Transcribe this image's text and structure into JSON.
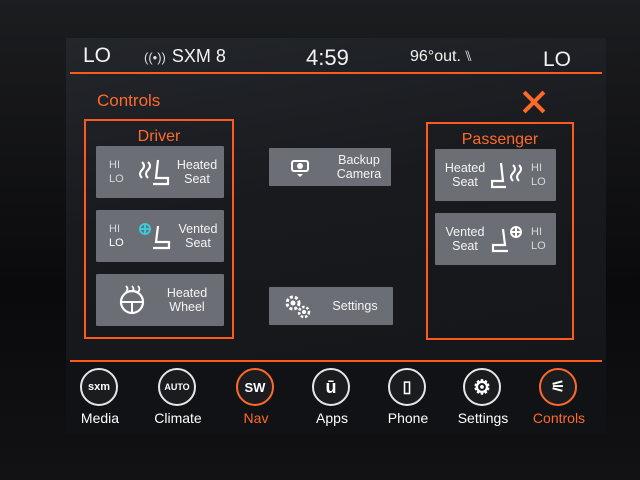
{
  "status": {
    "climate_left": "LO",
    "radio": "SXM 8",
    "time": "4:59",
    "outside_temp": "96°out.",
    "climate_right": "LO"
  },
  "page_title": "Controls",
  "driver": {
    "title": "Driver",
    "heated_seat": {
      "hi": "HI",
      "lo": "LO",
      "label_1": "Heated",
      "label_2": "Seat"
    },
    "vented_seat": {
      "hi": "HI",
      "lo": "LO",
      "label_1": "Vented",
      "label_2": "Seat"
    },
    "heated_wheel": {
      "label_1": "Heated",
      "label_2": "Wheel"
    }
  },
  "center": {
    "backup_camera": {
      "label_1": "Backup",
      "label_2": "Camera"
    },
    "settings": {
      "label": "Settings"
    }
  },
  "passenger": {
    "title": "Passenger",
    "heated_seat": {
      "hi": "HI",
      "lo": "LO",
      "label_1": "Heated",
      "label_2": "Seat"
    },
    "vented_seat": {
      "hi": "HI",
      "lo": "LO",
      "label_1": "Vented",
      "label_2": "Seat"
    }
  },
  "dock": [
    {
      "icon_text": "sxm",
      "label": "Media"
    },
    {
      "icon_text": "AUTO",
      "label": "Climate"
    },
    {
      "icon_text": "SW",
      "label": "Nav"
    },
    {
      "icon_text": "ū",
      "label": "Apps"
    },
    {
      "icon_text": "▯",
      "label": "Phone"
    },
    {
      "icon_text": "⚙",
      "label": "Settings"
    },
    {
      "icon_text": "⚟",
      "label": "Controls"
    }
  ],
  "colors": {
    "accent": "#ff5a1e",
    "tile": "#6b6e74",
    "background": "#181a1e"
  },
  "icons": {
    "close": "close-icon",
    "heated_seat": "heated-seat-icon",
    "vented_seat": "vented-seat-icon",
    "heated_wheel": "heated-wheel-icon",
    "camera": "camera-icon",
    "gear": "gear-icon",
    "antenna": "antenna-icon"
  }
}
